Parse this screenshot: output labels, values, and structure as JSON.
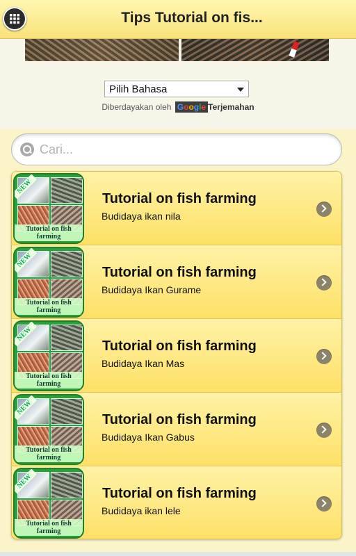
{
  "header": {
    "title": "Tips Tutorial on fis...",
    "menu_icon": "grid-icon"
  },
  "translate": {
    "selected_language": "Pilih Bahasa",
    "powered_by": "Diberdayakan oleh",
    "google_letters": [
      "G",
      "o",
      "o",
      "g",
      "l",
      "e"
    ],
    "translate_label": "Terjemahan"
  },
  "search": {
    "placeholder": "Cari...",
    "value": ""
  },
  "list": {
    "items": [
      {
        "title": "Tutorial on fish farming",
        "subtitle": "Budidaya ikan nila",
        "badge": "NEW",
        "caption_line1": "Tutorial on fish",
        "caption_line2": "farming"
      },
      {
        "title": "Tutorial on fish farming",
        "subtitle": "Budidaya Ikan Gurame",
        "badge": "NEW",
        "caption_line1": "Tutorial on fish",
        "caption_line2": "farming"
      },
      {
        "title": "Tutorial on fish farming",
        "subtitle": "Budidaya Ikan Mas",
        "badge": "NEW",
        "caption_line1": "Tutorial on fish",
        "caption_line2": "farming"
      },
      {
        "title": "Tutorial on fish farming",
        "subtitle": "Budidaya Ikan Gabus",
        "badge": "NEW",
        "caption_line1": "Tutorial on fish",
        "caption_line2": "farming"
      },
      {
        "title": "Tutorial on fish farming",
        "subtitle": "Budidaya ikan lele",
        "badge": "NEW",
        "caption_line1": "Tutorial on fish",
        "caption_line2": "farming"
      }
    ]
  },
  "colors": {
    "header_bg": "#f8e27a",
    "item_bg": "#fde066",
    "chevron_bg": "#8c8468"
  }
}
